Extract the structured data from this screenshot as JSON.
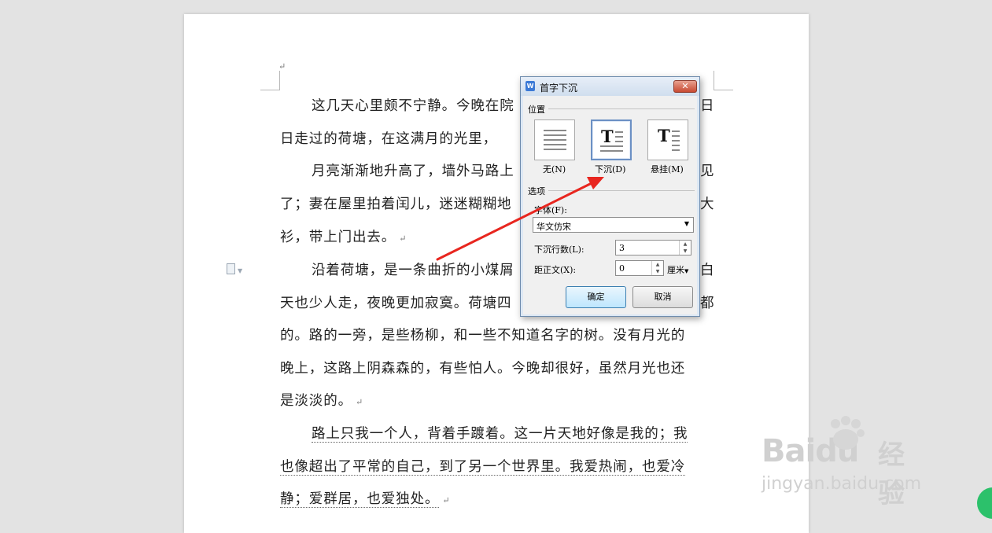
{
  "document": {
    "lines": [
      "这几天心里颇不宁静。今晚在院",
      "日走过的荷塘，在这满月的光里，",
      "月亮渐渐地升高了，墙外马路上",
      "了；妻在屋里拍着闰儿，迷迷糊糊地",
      "衫，带上门出去。",
      "沿着荷塘，是一条曲折的小煤屑",
      "天也少人走，夜晚更加寂寞。荷塘四",
      "的。路的一旁，是些杨柳，和一些不知道名字的树。没有月光的",
      "晚上，这路上阴森森的，有些怕人。今晚却很好，虽然月光也还",
      "是淡淡的。",
      "路上只我一个人，背着手踱着。这一片天地好像是我的；我",
      "也像超出了平常的自己，到了另一个世界里。我爱热闹，也爱冷",
      "静；爱群居，也爱独处。"
    ],
    "right_fragments": [
      "日",
      "见",
      "大",
      "白",
      "都"
    ],
    "return_mark": "↵"
  },
  "dialog": {
    "title": "首字下沉",
    "close_label": "✕",
    "section_position": "位置",
    "positions": [
      {
        "label": "无(N)",
        "selected": false
      },
      {
        "label": "下沉(D)",
        "selected": true
      },
      {
        "label": "悬挂(M)",
        "selected": false
      }
    ],
    "section_options": "选项",
    "font_label": "字体(F):",
    "font_value": "华文仿宋",
    "drop_lines_label": "下沉行数(L):",
    "drop_lines_value": "3",
    "distance_label": "距正文(X):",
    "distance_value": "0",
    "unit_label": "厘米",
    "ok_label": "确定",
    "cancel_label": "取消"
  },
  "watermark": {
    "brand": "Baidu",
    "brand_cn": "经验",
    "url": "jingyan.baidu.com"
  },
  "colors": {
    "arrow": "#e8261f",
    "selected_border": "#6b90c4",
    "close": "#c84a32"
  }
}
